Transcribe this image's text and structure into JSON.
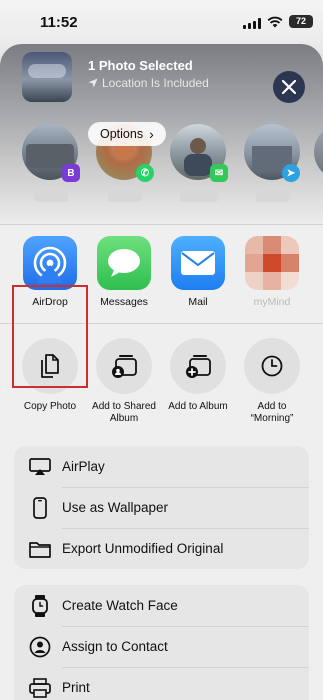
{
  "status": {
    "time": "11:52",
    "battery": "72"
  },
  "header": {
    "title": "1 Photo Selected",
    "subtitle": "Location Is Included",
    "options_label": "Options",
    "options_chevron": "›"
  },
  "apps": [
    {
      "label": "AirDrop",
      "icon": "airdrop-icon"
    },
    {
      "label": "Messages",
      "icon": "messages-icon"
    },
    {
      "label": "Mail",
      "icon": "mail-icon"
    },
    {
      "label": "myMind",
      "icon": "app-icon"
    }
  ],
  "actions": [
    {
      "label": "Copy Photo",
      "icon": "copy-icon"
    },
    {
      "label": "Add to Shared Album",
      "icon": "shared-album-icon"
    },
    {
      "label": "Add to Album",
      "icon": "add-album-icon"
    },
    {
      "label": "Add to “Morning”",
      "icon": "clock-icon"
    }
  ],
  "group1": [
    {
      "label": "AirPlay",
      "icon": "airplay-icon"
    },
    {
      "label": "Use as Wallpaper",
      "icon": "phone-icon"
    },
    {
      "label": "Export Unmodified Original",
      "icon": "folder-icon"
    }
  ],
  "group2": [
    {
      "label": "Create Watch Face",
      "icon": "watch-icon"
    },
    {
      "label": "Assign to Contact",
      "icon": "contact-icon"
    },
    {
      "label": "Print",
      "icon": "printer-icon"
    }
  ],
  "colors": {
    "highlight": "#cc2f2f",
    "messages_green": "#34c759",
    "mail_blue": "#1e8bf5",
    "airdrop_blue": "#2f7ff0"
  }
}
